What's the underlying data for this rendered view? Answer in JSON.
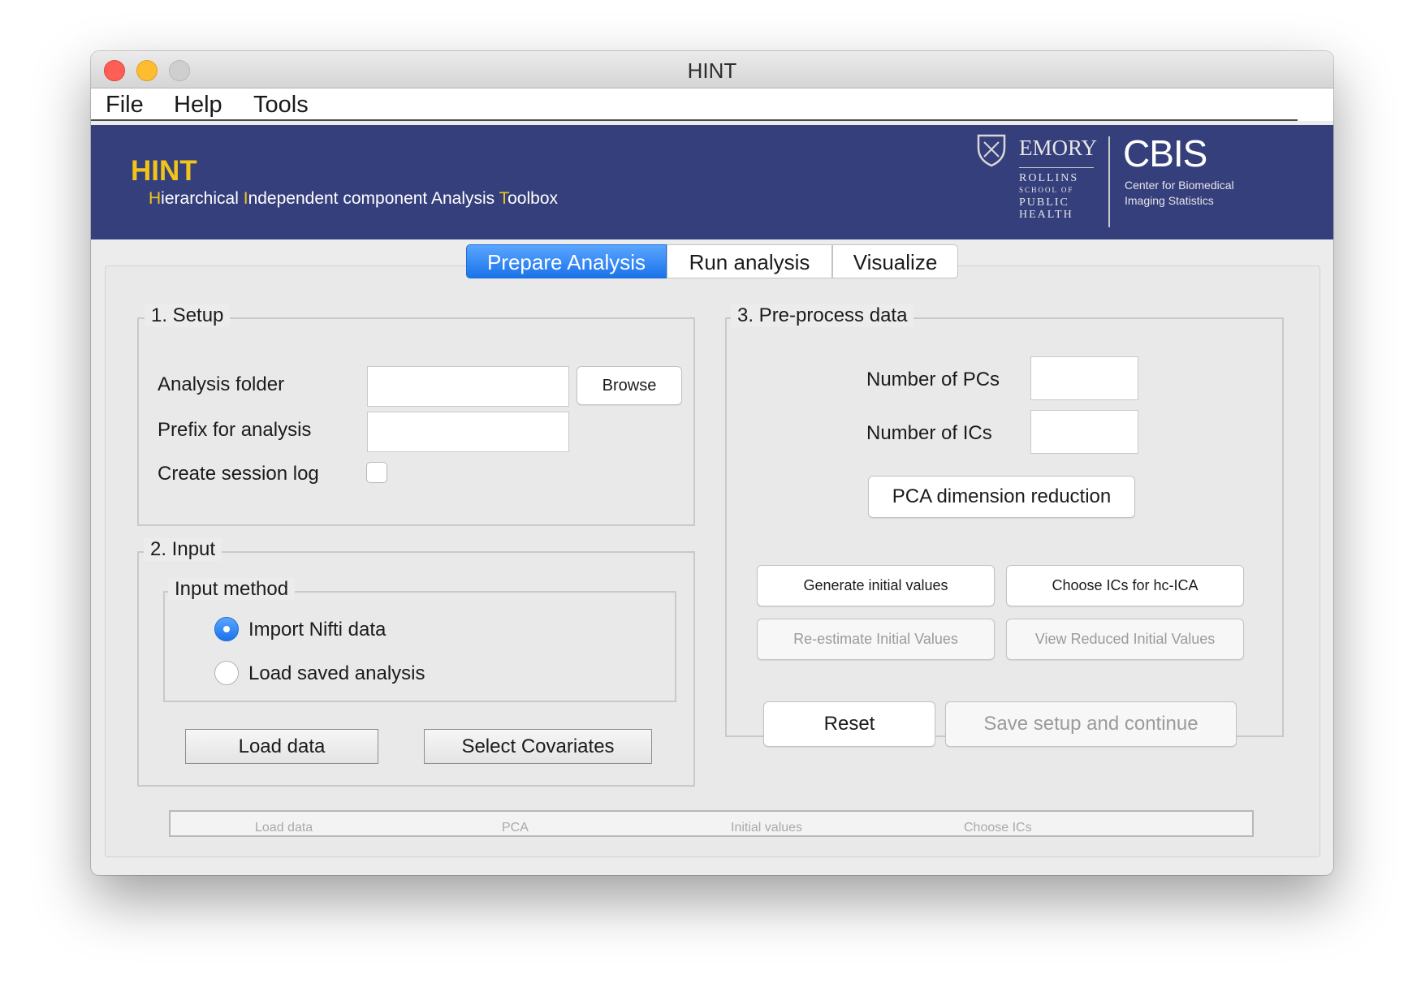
{
  "window": {
    "title": "HINT"
  },
  "menu": {
    "file": "File",
    "help": "Help",
    "tools": "Tools"
  },
  "banner": {
    "title": "HINT",
    "subtitle_words": [
      {
        "cap": "H",
        "rest": "ierarchical"
      },
      {
        "cap": "I",
        "rest": "ndependent"
      },
      {
        "cap": "",
        "rest": "component"
      },
      {
        "cap": "",
        "rest": "Analysis"
      },
      {
        "cap": "T",
        "rest": "oolbox"
      }
    ],
    "logo_emory": "EMORY",
    "logo_rollins_1": "ROLLINS",
    "logo_rollins_2": "SCHOOL OF",
    "logo_rollins_3": "PUBLIC",
    "logo_rollins_4": "HEALTH",
    "logo_cbis": "CBIS",
    "logo_cbis_sub1": "Center for Biomedical",
    "logo_cbis_sub2": "Imaging Statistics",
    "colors": {
      "background": "#353f7c",
      "accent": "#f0c419"
    }
  },
  "tabs": [
    {
      "label": "Prepare Analysis",
      "active": true
    },
    {
      "label": "Run analysis",
      "active": false
    },
    {
      "label": "Visualize",
      "active": false
    }
  ],
  "setup": {
    "legend": "1. Setup",
    "analysis_folder_label": "Analysis folder",
    "analysis_folder_value": "",
    "browse_label": "Browse",
    "prefix_label": "Prefix for analysis",
    "prefix_value": "",
    "session_log_label": "Create session log",
    "session_log_checked": false
  },
  "input": {
    "legend": "2. Input",
    "method_legend": "Input method",
    "options": [
      {
        "label": "Import Nifti data",
        "selected": true
      },
      {
        "label": "Load saved analysis",
        "selected": false
      }
    ],
    "load_data_label": "Load data",
    "select_covariates_label": "Select Covariates"
  },
  "preprocess": {
    "legend": "3. Pre-process data",
    "num_pcs_label": "Number of PCs",
    "num_pcs_value": "",
    "num_ics_label": "Number of ICs",
    "num_ics_value": "",
    "pca_button": "PCA dimension reduction",
    "generate_button": "Generate initial values",
    "choose_button": "Choose ICs for hc-ICA",
    "reestimate_button": "Re-estimate Initial Values",
    "view_reduced_button": "View Reduced Initial Values"
  },
  "actions": {
    "reset": "Reset",
    "save_continue": "Save setup and continue"
  },
  "progress_steps": [
    "Load data",
    "PCA",
    "Initial values",
    "Choose ICs"
  ]
}
